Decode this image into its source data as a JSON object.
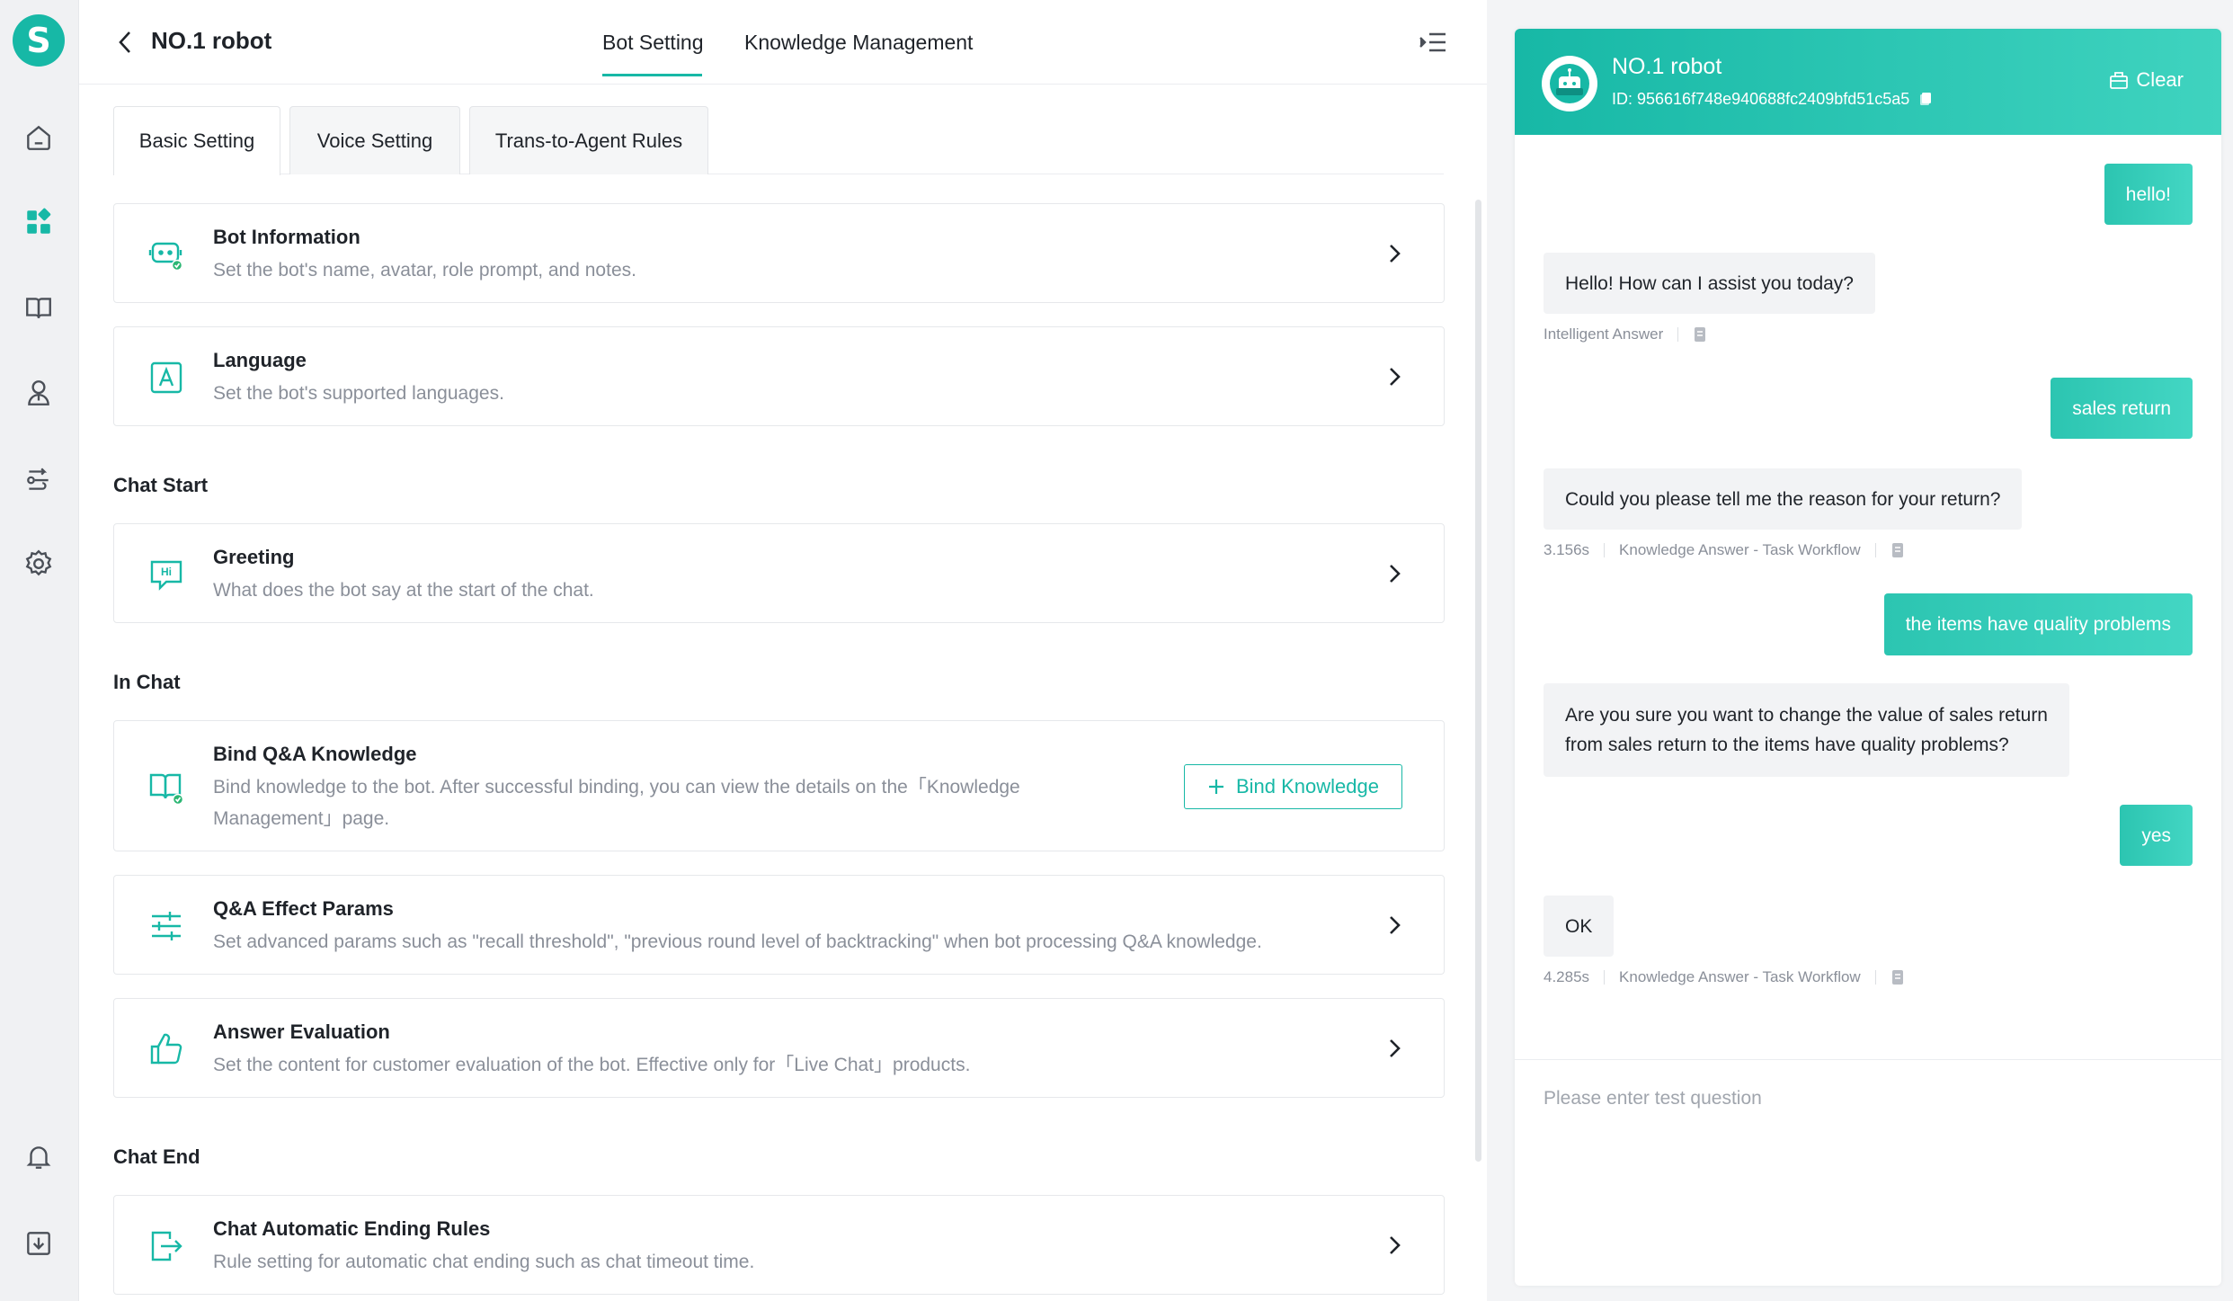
{
  "app": {
    "logo_letter": "S"
  },
  "sidebar": {
    "items": [
      {
        "name": "home",
        "icon": "home-icon"
      },
      {
        "name": "apps",
        "icon": "apps-icon"
      },
      {
        "name": "knowledge",
        "icon": "book-icon"
      },
      {
        "name": "users",
        "icon": "user-icon"
      },
      {
        "name": "workflow",
        "icon": "route-icon"
      },
      {
        "name": "settings",
        "icon": "gear-icon"
      },
      {
        "name": "notifications",
        "icon": "bell-icon"
      },
      {
        "name": "download",
        "icon": "download-icon"
      }
    ]
  },
  "header": {
    "title": "NO.1 robot",
    "tabs": [
      {
        "label": "Bot Setting",
        "active": true
      },
      {
        "label": "Knowledge Management",
        "active": false
      }
    ]
  },
  "sub_tabs": [
    {
      "label": "Basic Setting",
      "active": true
    },
    {
      "label": "Voice Setting",
      "active": false
    },
    {
      "label": "Trans-to-Agent Rules",
      "active": false
    }
  ],
  "settings": {
    "bot_info": {
      "title": "Bot Information",
      "desc": "Set the bot's name, avatar, role prompt, and notes."
    },
    "language": {
      "title": "Language",
      "desc": "Set the bot's supported languages."
    },
    "chat_start": {
      "section": "Chat Start",
      "greeting": {
        "title": "Greeting",
        "desc": "What does the bot say at the start of the chat."
      }
    },
    "in_chat": {
      "section": "In Chat",
      "bind_qa": {
        "title": "Bind Q&A Knowledge",
        "desc_line1": "Bind knowledge to the bot. After successful binding, you can view the details on the「Knowledge",
        "desc_line2": "Management」page.",
        "button": "Bind Knowledge"
      },
      "qa_params": {
        "title": "Q&A Effect Params",
        "desc": "Set advanced params such as \"recall threshold\", \"previous round level of backtracking\" when bot processing Q&A knowledge."
      },
      "answer_eval": {
        "title": "Answer Evaluation",
        "desc": "Set the content for customer evaluation of the bot. Effective only for「Live Chat」products."
      }
    },
    "chat_end": {
      "section": "Chat End",
      "auto_end": {
        "title": "Chat Automatic Ending Rules",
        "desc": "Rule setting for automatic chat ending such as chat timeout time."
      }
    }
  },
  "chat": {
    "name": "NO.1 robot",
    "id": "ID: 956616f748e940688fc2409bfd51c5a5",
    "clear_label": "Clear",
    "messages": [
      {
        "role": "user",
        "text": "hello!"
      },
      {
        "role": "bot",
        "text": "Hello! How can I assist you today?",
        "meta_time": "",
        "meta_source": "Intelligent Answer"
      },
      {
        "role": "user",
        "text": "sales return"
      },
      {
        "role": "bot",
        "text": "Could you please tell me the reason for your return?",
        "meta_time": "3.156s",
        "meta_source": "Knowledge Answer - Task Workflow"
      },
      {
        "role": "user",
        "text": "the items have quality problems"
      },
      {
        "role": "bot",
        "text_line1": "Are you sure you want to change the value of sales return",
        "text_line2": "from sales return to the items have quality problems?"
      },
      {
        "role": "user",
        "text": "yes"
      },
      {
        "role": "bot",
        "text": "OK",
        "meta_time": "4.285s",
        "meta_source": "Knowledge Answer - Task Workflow"
      }
    ],
    "input_placeholder": "Please enter test question"
  },
  "colors": {
    "accent": "#17b8a6",
    "accent_light": "#43d6c3",
    "text": "#1f2329",
    "muted": "#8a8f99"
  }
}
